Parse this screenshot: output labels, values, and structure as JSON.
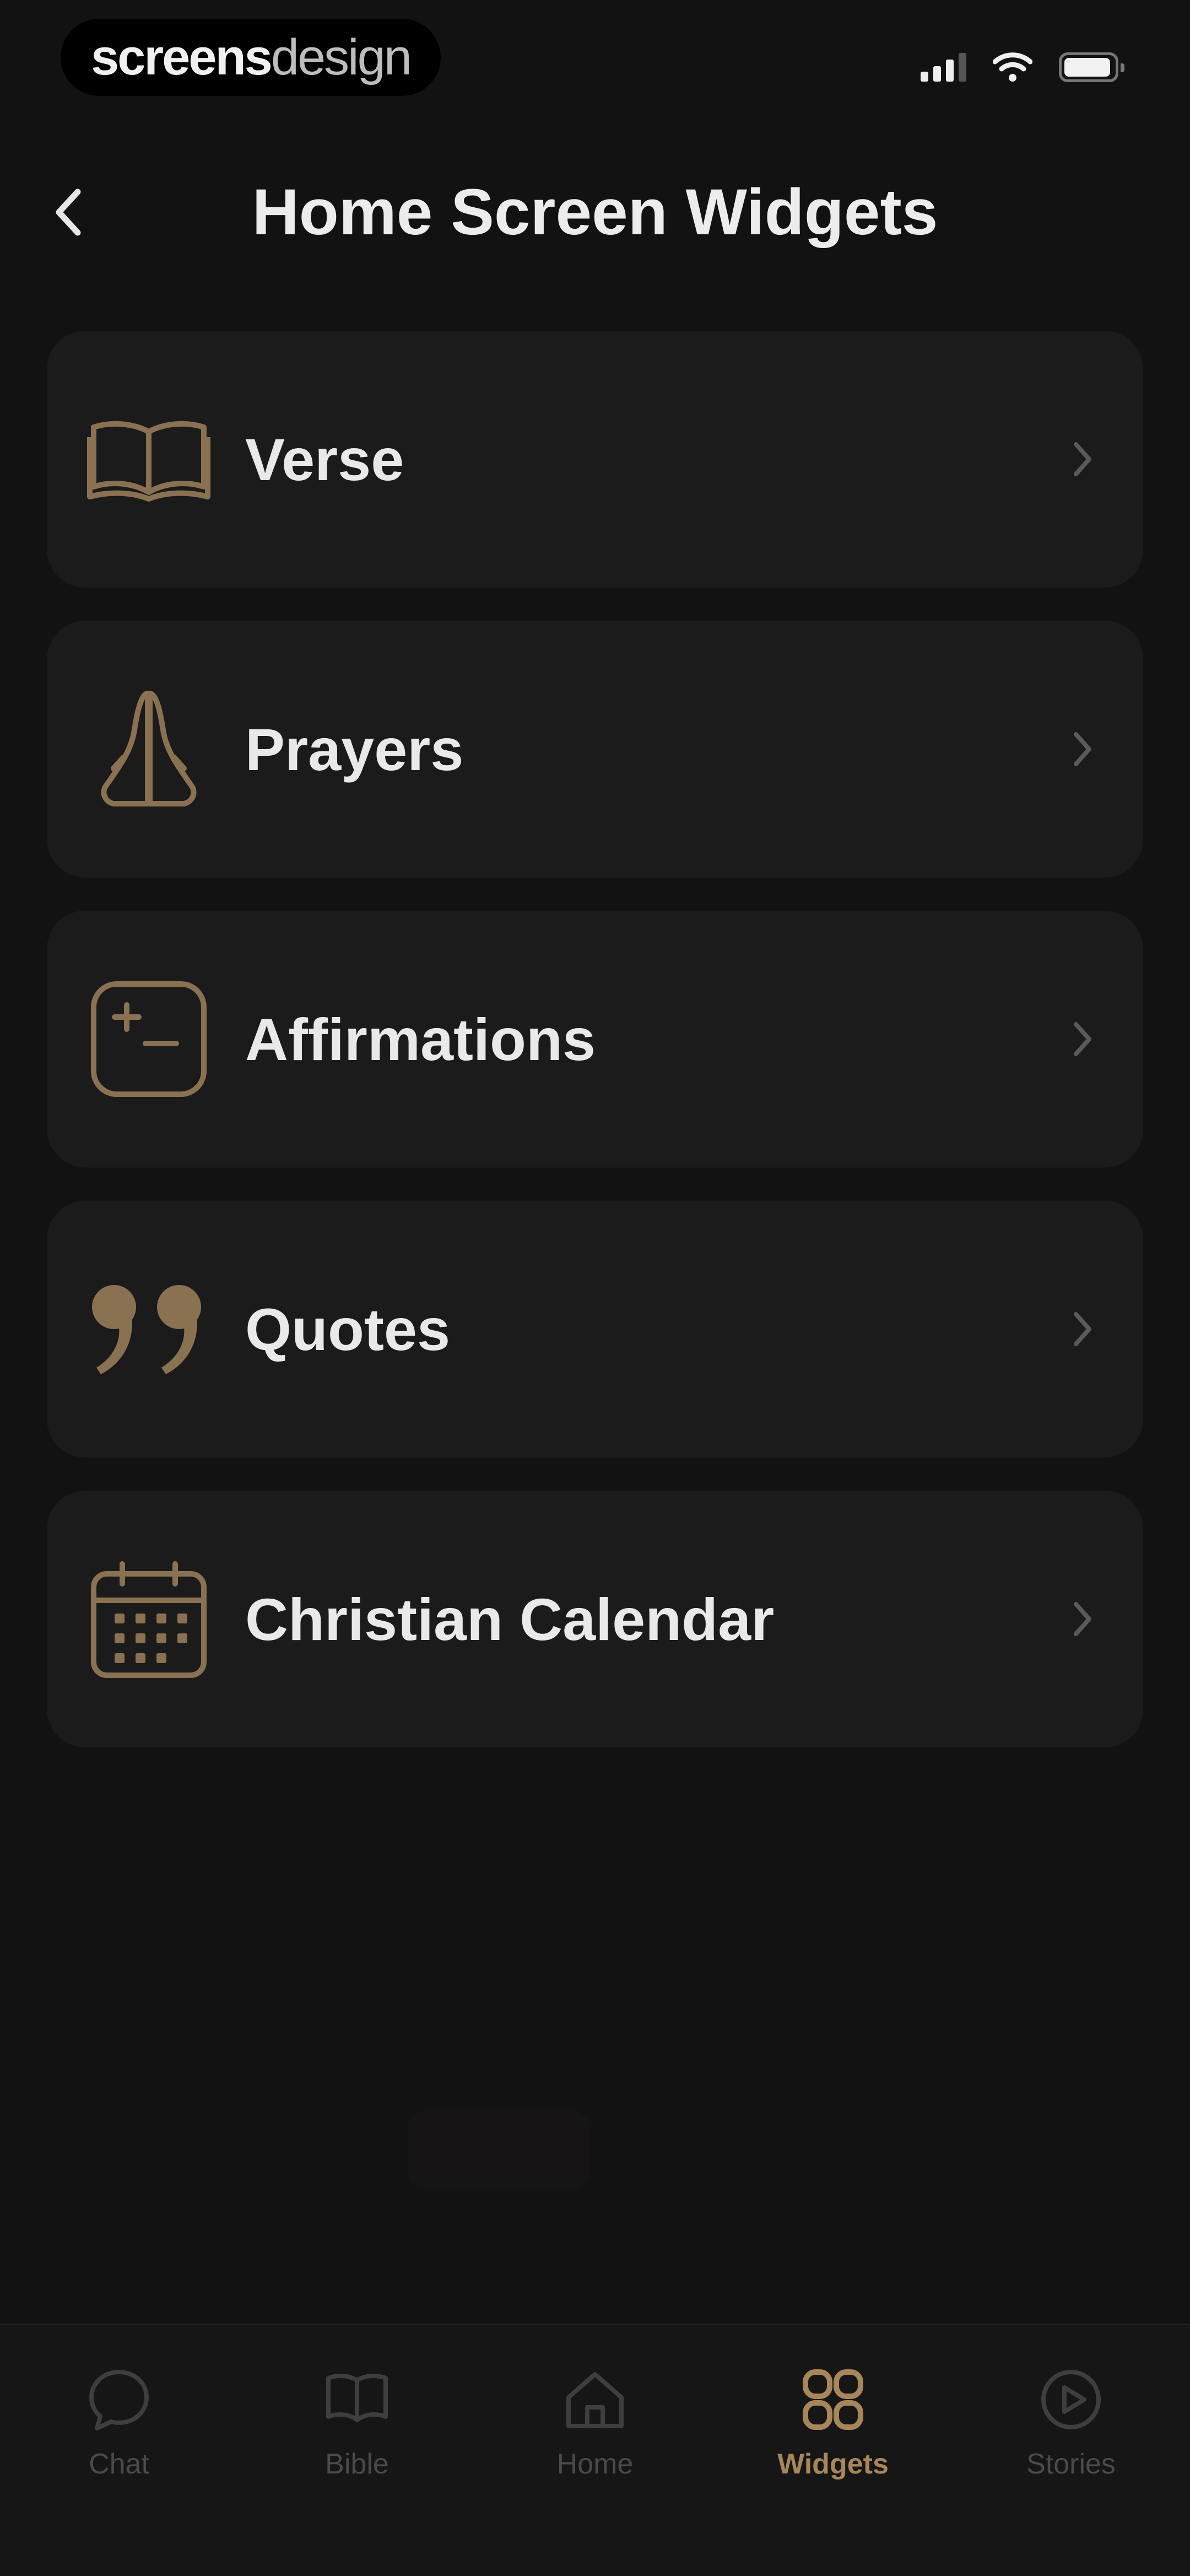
{
  "status_bar": {
    "brand_strong": "screens",
    "brand_light": "design",
    "signal_icon": "cellular-signal-icon",
    "wifi_icon": "wifi-icon",
    "battery_icon": "battery-icon"
  },
  "header": {
    "back_icon": "chevron-left-icon",
    "title": "Home Screen Widgets"
  },
  "widgets": [
    {
      "label": "Verse",
      "icon": "open-book-icon"
    },
    {
      "label": "Prayers",
      "icon": "praying-hands-icon"
    },
    {
      "label": "Affirmations",
      "icon": "sparkle-square-icon"
    },
    {
      "label": "Quotes",
      "icon": "quote-marks-icon"
    },
    {
      "label": "Christian Calendar",
      "icon": "calendar-icon"
    }
  ],
  "tab_bar": {
    "tabs": [
      {
        "label": "Chat",
        "icon": "chat-bubble-icon",
        "active": false
      },
      {
        "label": "Bible",
        "icon": "book-icon",
        "active": false
      },
      {
        "label": "Home",
        "icon": "home-icon",
        "active": false
      },
      {
        "label": "Widgets",
        "icon": "widgets-grid-icon",
        "active": true
      },
      {
        "label": "Stories",
        "icon": "play-circle-icon",
        "active": false
      }
    ]
  },
  "colors": {
    "background": "#121212",
    "card": "#1b1b1b",
    "accent": "#a8865b",
    "text": "#e9e9e9",
    "inactive": "#4a4a4a"
  }
}
